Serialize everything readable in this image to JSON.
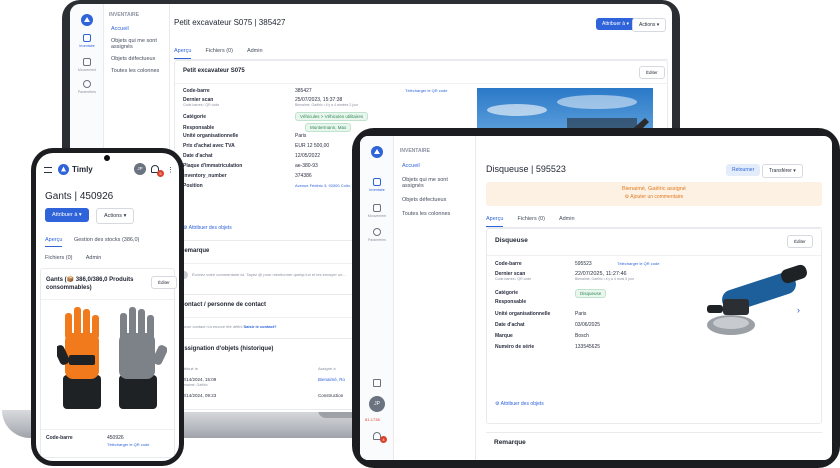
{
  "laptop": {
    "sidebar": {
      "section": "INVENTAIRE",
      "items": [
        "Accueil",
        "Objets qui me sont assignés",
        "Objets défectueux",
        "Toutes les colonnes"
      ],
      "rail": [
        "Inventaire",
        "Mouvement",
        "Paramètres"
      ]
    },
    "header": {
      "title": "Petit excavateur S075 | 385427",
      "assign_button": "Attribuer à ▾",
      "actions_button": "Actions ▾"
    },
    "tabs": [
      "Aperçu",
      "Fichiers (0)",
      "Admin"
    ],
    "card_title": "Petit excavateur S075",
    "edit_button": "Éditer",
    "fields": [
      {
        "label": "Code-barre",
        "value": "385427",
        "link": "Télécharger le QR code"
      },
      {
        "label": "Dernier scan",
        "value": "25/07/2023, 15:37:38",
        "sub_label": "Code-barres / QR code",
        "sub_value": "Bienaimé, Gaëlric • il y a 4 années 2 jour"
      },
      {
        "label": "Catégorie",
        "chip": "Véhicules > Véhicules utilitaires"
      },
      {
        "label": "Responsable",
        "chip": "Muntermann, Max"
      },
      {
        "label": "Unité organisationnelle",
        "value": "Paris"
      },
      {
        "label": "Prix d'achat avec TVA",
        "value": "EUR 12 500,00"
      },
      {
        "label": "Date d'achat",
        "value": "12/05/2022"
      },
      {
        "label": "Plaque d'immatriculation",
        "value": "ae-380-93"
      },
      {
        "label": "Inventory_number",
        "value": "374386"
      },
      {
        "label": "Position",
        "value": "Avenue Fédéric 3, 92000 Colin, De..."
      }
    ],
    "attribute_link": "Attribuer des objets",
    "remark_title": "Remarque",
    "comment_placeholder": "Écrivez votre commentaire ici. Tapez @ pour mentionner quelqu'un et les envoyer un...",
    "contact_title": "Contact / personne de contact",
    "contact_text": "Aucun contact n'a encore été défini",
    "contact_link": "Saisir le contact?",
    "history_title": "Assignation d'objets (historique)",
    "history_cols": [
      "Attribué le",
      "Assigné à"
    ],
    "history_rows": [
      {
        "date": "02/14/2024, 15:09",
        "by": "Bienaimé, Gaëlric",
        "to": "Bienaimé, Ro"
      },
      {
        "date": "02/14/2024, 09:23",
        "by": "",
        "to": "Construction"
      }
    ]
  },
  "tablet": {
    "sidebar": {
      "section": "INVENTAIRE",
      "items": [
        "Accueil",
        "Objets qui me sont assignés",
        "Objets défectueux",
        "Toutes les colonnes"
      ],
      "rail": [
        "Inventaire",
        "Mouvement",
        "Paramètres"
      ],
      "avatar": "JP",
      "badge_text": "81-1738",
      "notif_count": "4"
    },
    "header": {
      "title": "Disqueuse | 595523",
      "return_button": "Retourner",
      "transfer_button": "Transférer ▾"
    },
    "banner": {
      "text": "Bienaimé, Gaëlric assigné",
      "link": "Ajouter un commentaire"
    },
    "tabs": [
      "Aperçu",
      "Fichiers (0)",
      "Admin"
    ],
    "card_title": "Disqueuse",
    "edit_button": "Éditer",
    "fields": [
      {
        "label": "Code-barre",
        "value": "595523",
        "link": "Télécharger le QR code"
      },
      {
        "label": "Dernier scan",
        "value": "22/07/2025, 11:27:46",
        "sub_label": "Code-barres / QR code",
        "sub_value": "Bienaimé, Gaëlric • il y a 4 mois 5 jour"
      },
      {
        "label": "Catégorie",
        "chip": "Disqueuse"
      },
      {
        "label": "Responsable",
        "value": ""
      },
      {
        "label": "Unité organisationnelle",
        "value": "Paris"
      },
      {
        "label": "Date d'achat",
        "value": "03/06/2025"
      },
      {
        "label": "Marque",
        "value": "Bosch"
      },
      {
        "label": "Numéro de série",
        "value": "133545625"
      }
    ],
    "attribute_link": "Attribuer des objets",
    "remark_title": "Remarque"
  },
  "phone": {
    "status_time": "",
    "brand": "Timly",
    "avatar": "JP",
    "notif_count": "5",
    "title": "Gants | 450926",
    "assign_button": "Attribuer à ▾",
    "actions_button": "Actions ▾",
    "tabs": [
      "Aperçu",
      "Gestion des stocks (386,0)",
      "Fichiers (0)",
      "Admin"
    ],
    "card_title": "Gants (📦 386,0/386,0 Produits consommables)",
    "edit_button": "Éditer",
    "barcode_label": "Code-barre",
    "barcode_value": "450926",
    "barcode_link": "Télécharger le QR code"
  },
  "colors": {
    "accent": "#2f63d9",
    "banner_bg": "#fdf1e4",
    "banner_text": "#e07a1f",
    "chip_green": "#2f8a55"
  }
}
